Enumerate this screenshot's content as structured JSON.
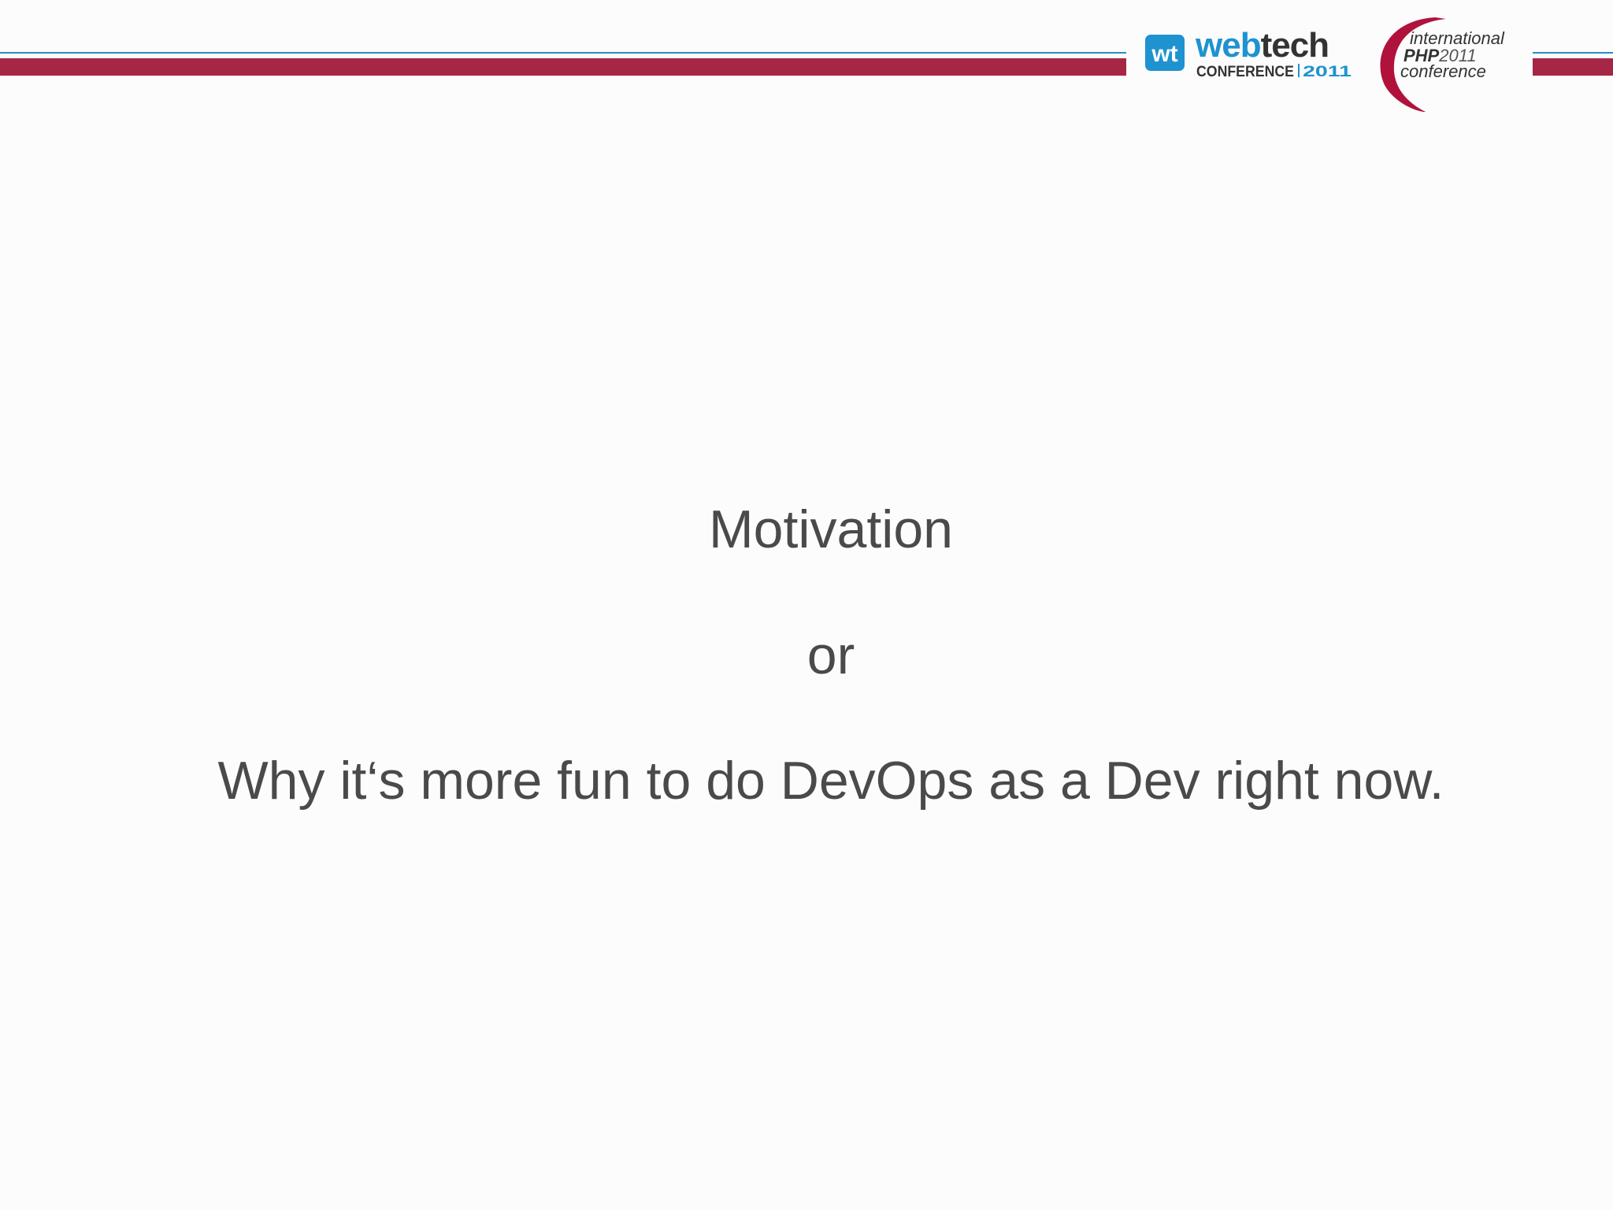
{
  "header": {
    "logos": [
      {
        "name": "webtech conference 2011",
        "mark": "wt",
        "word_dark": "web",
        "word_light": "tech",
        "subtitle_left": "CONFERENCE",
        "subtitle_right": "2011"
      },
      {
        "name": "international PHP 2011 conference",
        "line1": "international",
        "line2_bold": "PHP",
        "line2_light": "2011",
        "line3": "conference"
      }
    ],
    "colors": {
      "accent_red": "#a62645",
      "accent_blue": "#2c8bc4",
      "webtech_blue": "#1f92d0"
    }
  },
  "slide": {
    "lines": [
      "Motivation",
      "or",
      "Why it‘s more fun to do DevOps as a Dev right now."
    ]
  }
}
